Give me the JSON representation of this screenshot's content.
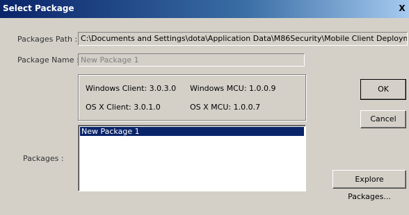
{
  "window": {
    "title": "Select Package",
    "close_glyph": "X"
  },
  "form": {
    "packages_path_label": "Packages Path :",
    "packages_path_value": "C:\\Documents and Settings\\dota\\Application Data\\M86Security\\Mobile Client Deployment Kit\\Pack",
    "package_name_label": "Package Name :",
    "package_name_placeholder": "New Package 1",
    "packages_label": "Packages :"
  },
  "versions": {
    "windows_client": "Windows Client: 3.0.3.0",
    "windows_mcu": "Windows MCU: 1.0.0.9",
    "osx_client": "OS X Client: 3.0.1.0",
    "osx_mcu": "OS X MCU: 1.0.0.7"
  },
  "packages_list": {
    "items": [
      "New Package 1"
    ],
    "selected_index": 0
  },
  "buttons": {
    "ok": "OK",
    "cancel": "Cancel",
    "explore": "Explore Packages..."
  },
  "colors": {
    "face": "#d4d0c8",
    "title_start": "#0a246a",
    "title_end": "#a6caf0",
    "selection": "#0a246a"
  }
}
